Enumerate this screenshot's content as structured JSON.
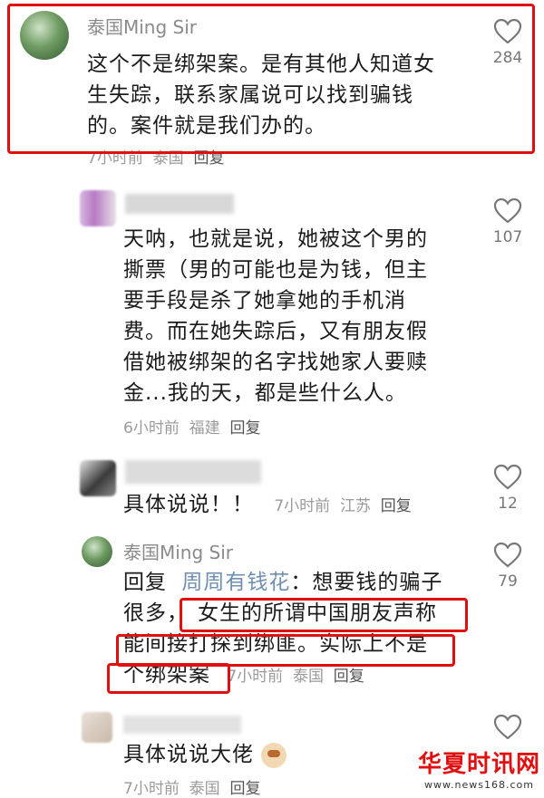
{
  "comments": [
    {
      "username": "泰国Ming Sir",
      "lines": [
        "这个不是绑架案。是有其他人知道女",
        "生失踪，联系家属说可以找到骗钱",
        "的。案件就是我们办的。"
      ],
      "time": "7小时前",
      "location": "泰国",
      "reply": "回复",
      "likes": "284"
    },
    {
      "lines": [
        "天呐，也就是说，她被这个男的",
        "撕票（男的可能也是为钱，但主",
        "要手段是杀了她拿她的手机消",
        "费。而在她失踪后，又有朋友假",
        "借她被绑架的名字找她家人要赎",
        "金...我的天，都是些什么人。"
      ],
      "time": "6小时前",
      "location": "福建",
      "reply": "回复",
      "likes": "107"
    },
    {
      "text": "具体说说！！",
      "time": "7小时前",
      "location": "江苏",
      "reply": "回复",
      "likes": "12"
    },
    {
      "username": "泰国Ming Sir",
      "reply_prefix": "回复",
      "mention": "周周有钱花",
      "line1_rest": "：想要钱的骗子",
      "line2_a": "很多，",
      "line2_b": "女生的所谓中国朋友声称",
      "line3": "能间接打探到绑匪。实际上不是",
      "line4": "个绑架案",
      "time": "7小时前",
      "location": "泰国",
      "reply": "回复",
      "likes": "79"
    },
    {
      "text": "具体说说大佬",
      "time": "7小时前",
      "location": "泰国",
      "reply": "回复"
    }
  ],
  "watermark": {
    "main": "华夏时讯网",
    "sub": "www.news168.com"
  },
  "colors": {
    "highlight": "#e01010",
    "mention": "#6f8fb0"
  }
}
